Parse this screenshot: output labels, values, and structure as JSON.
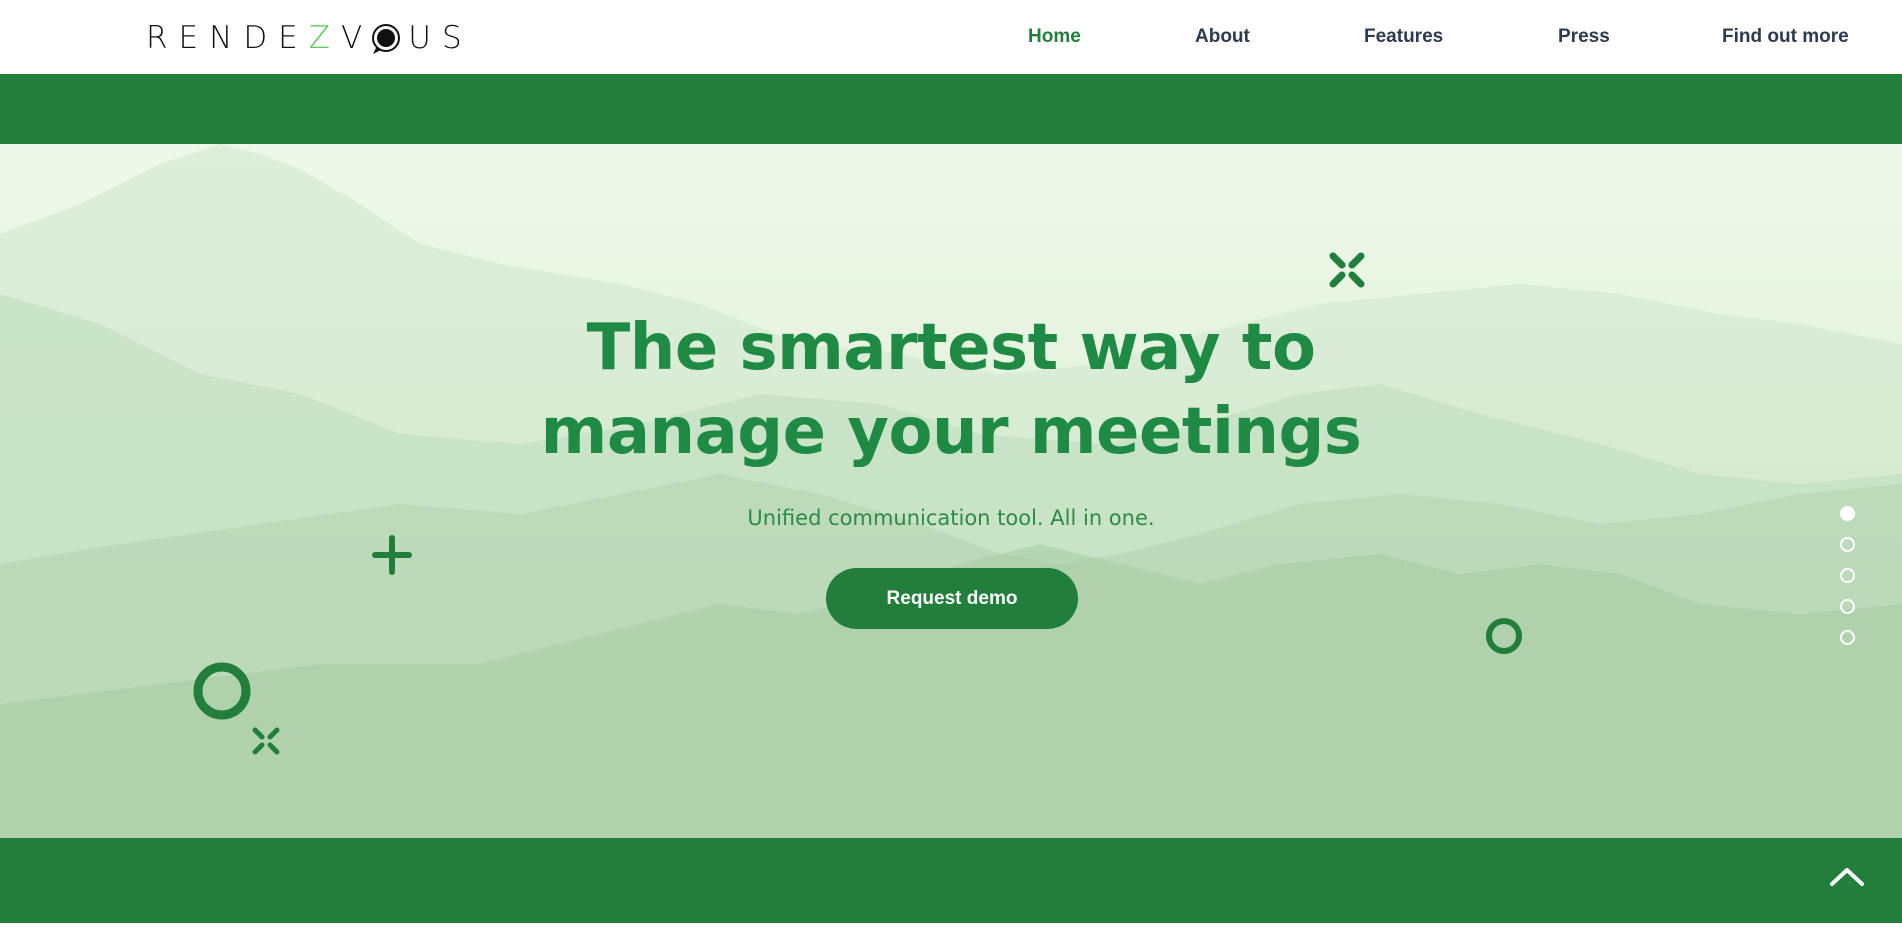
{
  "brand": {
    "logo_part1": "RENDE",
    "logo_part2": "Z",
    "logo_part3": "V",
    "logo_part4": "US",
    "logo_bubble_icon": "chat-bubble-icon",
    "accent_color": "#5cc45a"
  },
  "nav": {
    "items": [
      {
        "label": "Home",
        "active": true
      },
      {
        "label": "About",
        "active": false
      },
      {
        "label": "Features",
        "active": false
      },
      {
        "label": "Press",
        "active": false
      },
      {
        "label": "Find out more",
        "active": false
      }
    ]
  },
  "hero": {
    "headline_line1": "The smartest way to",
    "headline_line2": "manage your meetings",
    "subheadline": "Unified communication tool. All in one.",
    "cta_label": "Request demo",
    "slide_count": 5,
    "active_slide": 1
  },
  "colors": {
    "primary_green": "#217e3b",
    "headline_green": "#1f8a43",
    "nav_text": "#2d3b4e",
    "hero_bg": "#e3f3dd"
  },
  "icons": {
    "plus": "plus-icon",
    "circle": "ring-icon",
    "cross": "x-mark-icon",
    "scroll_top": "chevron-up-icon"
  }
}
